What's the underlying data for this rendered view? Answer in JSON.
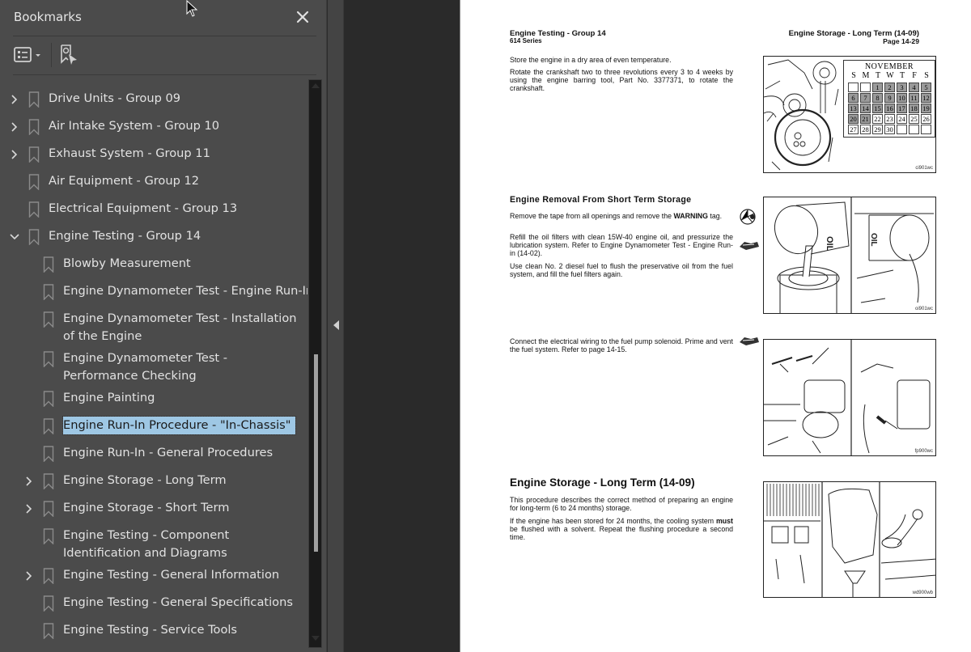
{
  "sidebar": {
    "title": "Bookmarks",
    "close_icon": "close-icon",
    "toolbar": {
      "options_icon": "options-list-icon",
      "find_bookmark_icon": "find-current-bookmark-icon"
    },
    "items": [
      {
        "label": "Drive Units - Group 09",
        "level": 0,
        "expandable": true,
        "expanded": false
      },
      {
        "label": "Air Intake System - Group 10",
        "level": 0,
        "expandable": true,
        "expanded": false
      },
      {
        "label": "Exhaust System - Group 11",
        "level": 0,
        "expandable": true,
        "expanded": false
      },
      {
        "label": "Air Equipment - Group 12",
        "level": 0,
        "expandable": false
      },
      {
        "label": "Electrical Equipment - Group 13",
        "level": 0,
        "expandable": false
      },
      {
        "label": "Engine Testing - Group 14",
        "level": 0,
        "expandable": true,
        "expanded": true
      },
      {
        "label": "Blowby Measurement",
        "level": 1,
        "expandable": false
      },
      {
        "label": "Engine Dynamometer Test - Engine Run-In",
        "level": 1,
        "expandable": false
      },
      {
        "label": "Engine Dynamometer Test - Installation of the Engine",
        "level": 1,
        "expandable": false
      },
      {
        "label": "Engine Dynamometer Test - Performance Checking",
        "level": 1,
        "expandable": false
      },
      {
        "label": "Engine Painting",
        "level": 1,
        "expandable": false
      },
      {
        "label": "Engine Run-In Procedure - \"In-Chassis\"",
        "level": 1,
        "expandable": false,
        "selected": true
      },
      {
        "label": "Engine Run-In - General Procedures",
        "level": 1,
        "expandable": false
      },
      {
        "label": "Engine Storage - Long Term",
        "level": 1,
        "expandable": true,
        "expanded": false
      },
      {
        "label": "Engine Storage - Short Term",
        "level": 1,
        "expandable": true,
        "expanded": false
      },
      {
        "label": "Engine Testing - Component Identification and Diagrams",
        "level": 1,
        "expandable": false
      },
      {
        "label": "Engine Testing - General Information",
        "level": 1,
        "expandable": true,
        "expanded": false
      },
      {
        "label": "Engine Testing - General Specifications",
        "level": 1,
        "expandable": false
      },
      {
        "label": "Engine Testing - Service Tools",
        "level": 1,
        "expandable": false
      }
    ],
    "selected_color": "#9ec7e4"
  },
  "document": {
    "header": {
      "left_title": "Engine Testing - Group 14",
      "left_subtitle": "614 Series",
      "right_title": "Engine Storage - Long Term (14-09)",
      "right_page": "Page 14-29"
    },
    "sections": [
      {
        "paragraphs": [
          "Store the engine in a dry area of even temperature.",
          "Rotate the crankshaft two to three revolutions every 3 to 4 weeks by using the engine barring tool, Part No. 3377371, to rotate the crankshaft."
        ],
        "figure_code": "ci901wc"
      },
      {
        "heading": "Engine Removal From Short Term Storage",
        "paragraphs": [
          "Remove the tape from all openings and remove the",
          "WARNING",
          " tag.",
          "Refill the oil filters with clean 15W-40 engine oil, and pressurize the lubrication system. Refer to Engine Dynamometer Test - Engine Run-in (14-02).",
          "Use clean No. 2 diesel fuel to flush the preservative oil from the fuel system, and fill the fuel filters again."
        ],
        "figure_code": "oi901wc",
        "filter_label": "OIL",
        "filter_oil": "15W-40"
      },
      {
        "paragraphs": [
          "Connect the electrical wiring to the fuel pump solenoid. Prime and vent the fuel system. Refer to page 14-15."
        ],
        "figure_code": "fp900wc"
      },
      {
        "heading": "Engine Storage - Long Term (14-09)",
        "paragraphs": [
          "This procedure describes the correct method of preparing an engine for long-term (6 to 24 months) storage.",
          "If the engine has been stored for 24 months, the cooling system ",
          "must",
          " be flushed with a solvent. Repeat the flushing procedure a second time."
        ],
        "figure_code": "wd900wb"
      }
    ],
    "calendar": {
      "month": "NOVEMBER",
      "days_of_week": [
        "S",
        "M",
        "T",
        "W",
        "T",
        "F",
        "S"
      ],
      "weeks": [
        [
          "",
          "",
          "1",
          "2",
          "3",
          "4",
          "5"
        ],
        [
          "6",
          "7",
          "8",
          "9",
          "10",
          "11",
          "12"
        ],
        [
          "13",
          "14",
          "15",
          "16",
          "17",
          "18",
          "19"
        ],
        [
          "20",
          "21",
          "22",
          "23",
          "24",
          "25",
          "26"
        ],
        [
          "27",
          "28",
          "29",
          "30",
          "",
          "",
          ""
        ]
      ],
      "shaded_through": "21"
    }
  }
}
